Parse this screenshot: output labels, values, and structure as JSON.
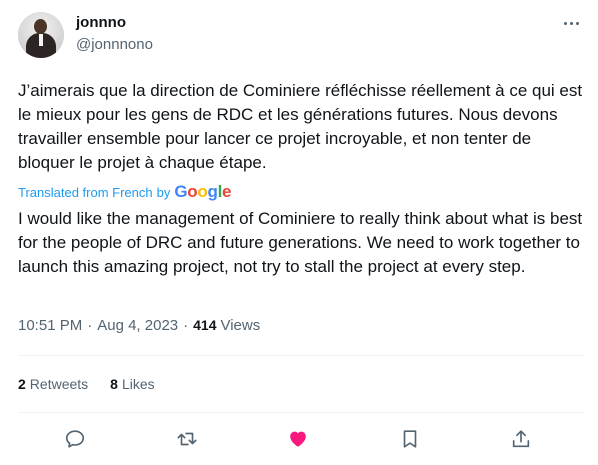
{
  "author": {
    "display_name": "jonnno",
    "handle": "@jonnnono"
  },
  "tweet": {
    "original_text": "J’aimerais que la direction de Cominiere réfléchisse réellement à ce qui est le mieux pour les gens de RDC et les générations futures. Nous devons travailler ensemble pour lancer ce projet incroyable, et non tenter de bloquer le projet à chaque étape.",
    "translated_label": "Translated from French",
    "translated_by": "by",
    "translation_provider": "Google",
    "translated_text": "I would like the management of Cominiere to really think about what is best for the people of DRC and future generations. We need to work together to launch this amazing project, not try to stall the project at every step.",
    "time": "10:51 PM",
    "separator": "·",
    "date": "Aug 4, 2023",
    "views_count": "414",
    "views_label": "Views"
  },
  "stats": {
    "retweets_count": "2",
    "retweets_label": "Retweets",
    "likes_count": "8",
    "likes_label": "Likes"
  },
  "colors": {
    "link_blue": "#1d9bf0",
    "muted_gray": "#536471",
    "liked_pink": "#f91880",
    "text": "#0f1419"
  },
  "icons": {
    "more": "more-icon",
    "reply": "reply-icon",
    "retweet": "retweet-icon",
    "like": "heart-icon",
    "bookmark": "bookmark-icon",
    "share": "share-icon"
  }
}
